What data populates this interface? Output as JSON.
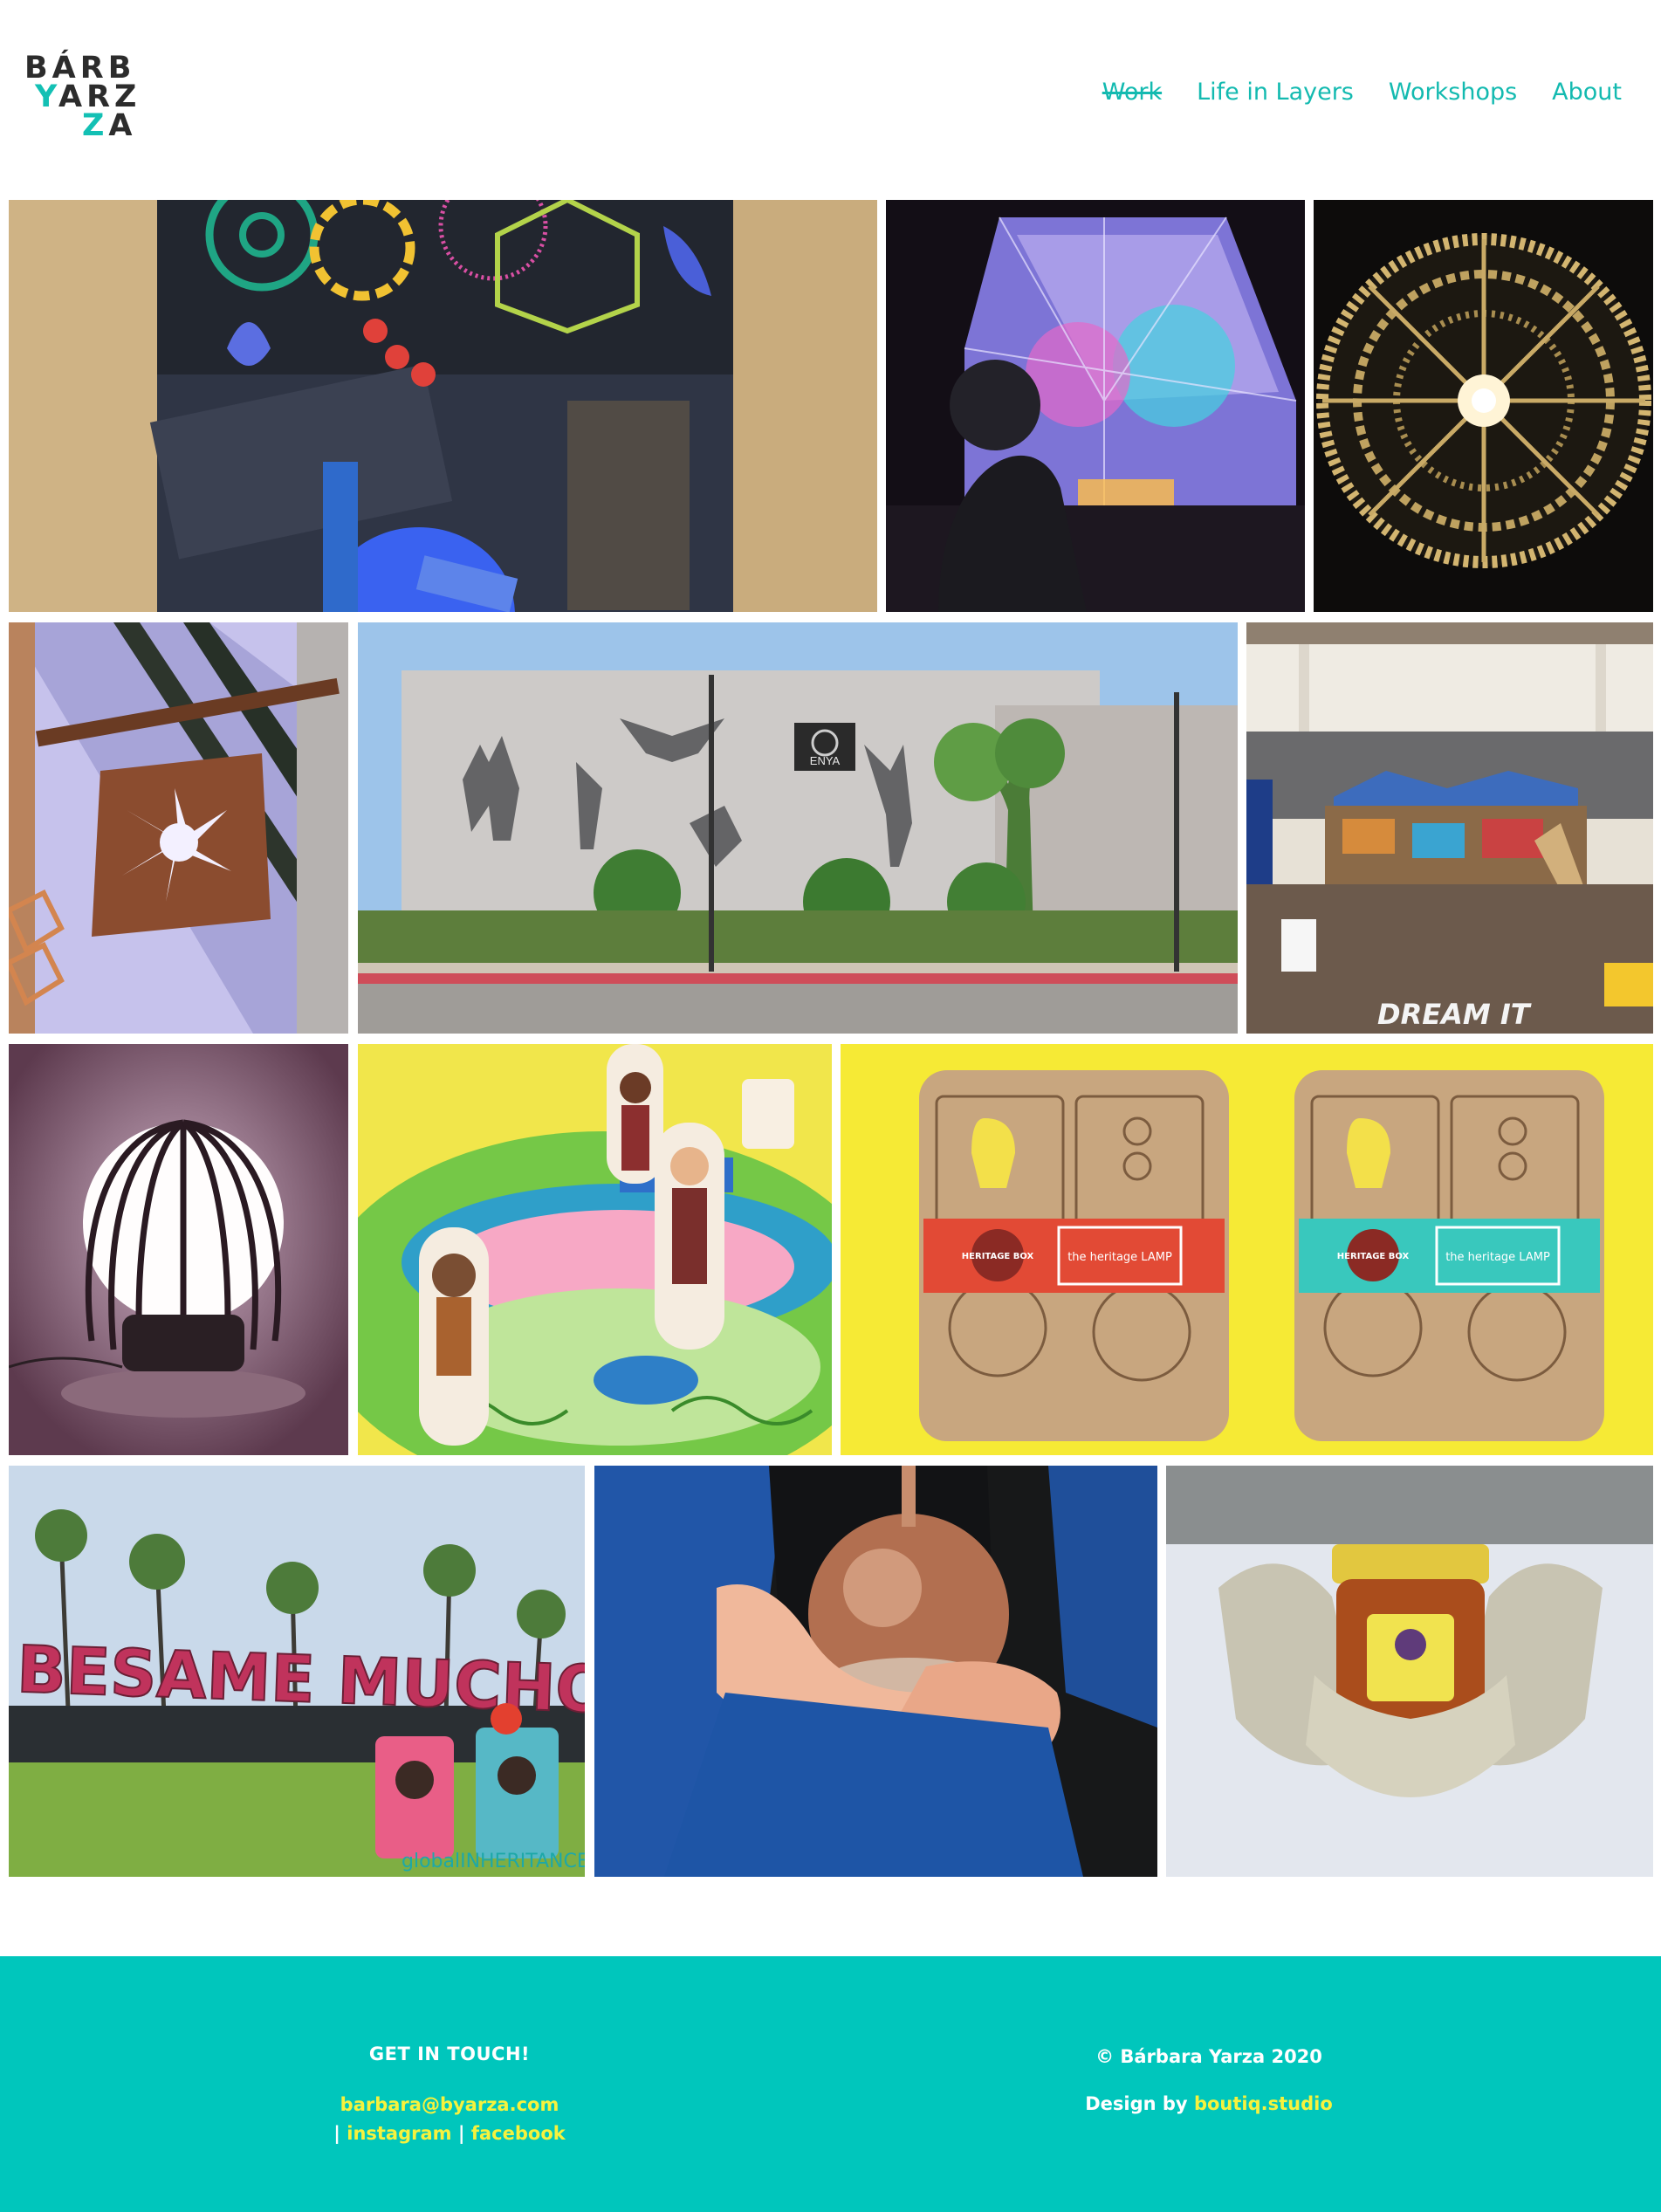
{
  "brand": {
    "logo_line1": "BÁRB",
    "logo_line2_accent": "Y",
    "logo_line2_rest": "ARZ",
    "logo_line3_accent": "Z",
    "logo_line3_rest": "A",
    "accent_color": "#13c0b4"
  },
  "nav": {
    "items": [
      {
        "label": "Work",
        "active": true
      },
      {
        "label": "Life in Layers"
      },
      {
        "label": "Workshops"
      },
      {
        "label": "About"
      }
    ]
  },
  "gallery": {
    "tiles": [
      {
        "icon": "window-mandala-image"
      },
      {
        "icon": "geodesic-dome-image"
      },
      {
        "icon": "golden-chandelier-image"
      },
      {
        "icon": "copper-sign-image"
      },
      {
        "icon": "mural-wall-image",
        "text": "ENYA"
      },
      {
        "icon": "maker-booth-image",
        "text": "DREAM IT"
      },
      {
        "icon": "cage-lamp-image"
      },
      {
        "icon": "board-game-image"
      },
      {
        "icon": "heritage-lamp-image",
        "text": "the heritage LAMP",
        "badge": "HERITAGE BOX"
      },
      {
        "icon": "besame-mucho-image",
        "text": "BESAME MUCHO",
        "caption": "globalINHERITANCE"
      },
      {
        "icon": "copper-ornament-image"
      },
      {
        "icon": "honey-jar-image"
      }
    ]
  },
  "footer": {
    "background": "#00c6bc",
    "contact_heading": "GET IN TOUCH!",
    "email": "barbara@byarza.com",
    "separator": "|",
    "instagram": "instagram",
    "facebook": "facebook",
    "copyright": "© Bárbara Yarza 2020",
    "design_prefix": "Design by",
    "design_link": "boutiq.studio"
  }
}
